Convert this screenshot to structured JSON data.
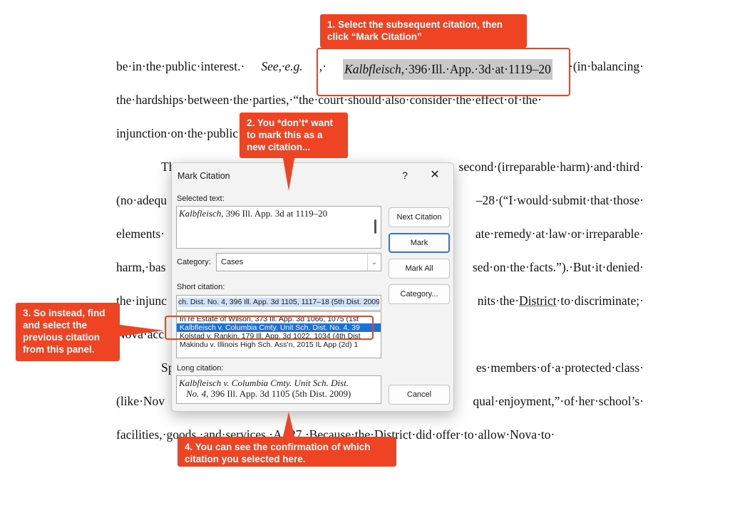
{
  "document": {
    "line1": {
      "prefix": "be·in·the·public·interest.·",
      "see": "See,·e.g.",
      "comma": ",·",
      "case_name": "Kalbfleisch",
      "citation": ",·396·Ill.·App.·3d·at·1119–20",
      "suffix": "·(in·balancing·"
    },
    "line2": "the·hardships·between·the·parties,·“the·court·should·also·consider·the·effect·of·the·",
    "line3": "injunction·on·the·public",
    "line4_start": "The·trial·court·concluded·that·Nova·had·met·the·second·(irreparable·harm)·and·third·",
    "line4_visible_left": "Th",
    "line4_visible_right": "second·(irreparable·harm)·and·third·",
    "line5_left": "(no·adequ",
    "line5_right": "–28·(“I·would·submit·that·those·",
    "line6_left": "elements·",
    "line6_right": "ate·remedy·at·law·or·irreparable·",
    "line7_left": "harm,·bas",
    "line7_right": "sed·on·the·facts.”).·But·it·denied·",
    "line8_left": "the·injunc",
    "line8_mid": "nits·the·",
    "line8_link": "District",
    "line8_right": "·to·discriminate;·",
    "line9_left": "Nova·acc",
    "line10_left": "Sp",
    "line10_right": "es·members·of·a·protected·class·",
    "line11_left": "(like·Nov",
    "line11_right": "qual·enjoyment,”·of·her·school’s·",
    "line12_left": "facilities,·goods,·and·services.·A.·27.·Because·the·District·did·offer·to·allow·Nova·to·"
  },
  "dialog": {
    "title": "Mark Citation",
    "help": "?",
    "close": "✕",
    "selected_text_label": "Selected text:",
    "selected_text_case": "Kalbfleisch",
    "selected_text_rest": ", 396 Ill. App. 3d at 1119–20",
    "category_label": "Category:",
    "category_value": "Cases",
    "short_citation_label": "Short citation:",
    "short_citation_value": "ch. Dist. No. 4, 396 Ill. App. 3d 1105, 1117–18 (5th Dist. 2009)",
    "short_list": [
      "In re Estate of Wilson, 373 Ill. App. 3d 1066, 1075 (1st",
      "Kalbfleisch v. Columbia Cmty. Unit Sch. Dist. No. 4, 39",
      "Kolstad v. Rankin, 179 Ill. App. 3d 1022, 1034 (4th Dist",
      "Makindu v. Illinois High Sch. Ass’n, 2015 IL App (2d) 1"
    ],
    "long_citation_label": "Long citation:",
    "long_citation_line1": "Kalbfleisch v. Columbia Cmty. Unit Sch. Dist.",
    "long_citation_line2_italic": "No. 4",
    "long_citation_line2_rest": ", 396 Ill. App. 3d 1105 (5th Dist. 2009)",
    "buttons": {
      "next_citation": "Next Citation",
      "mark": "Mark",
      "mark_all": "Mark All",
      "category": "Category...",
      "cancel": "Cancel"
    }
  },
  "annotations": {
    "step1": "1. Select the subsequent citation, then click “Mark Citation”",
    "step2": "2. You *don’t* want to mark this as a new citation...",
    "step3": "3. So instead, find and select the previous citation from this panel.",
    "step4": "4. You can see the confirmation of which citation you selected here.",
    "color": "#ef4423"
  }
}
